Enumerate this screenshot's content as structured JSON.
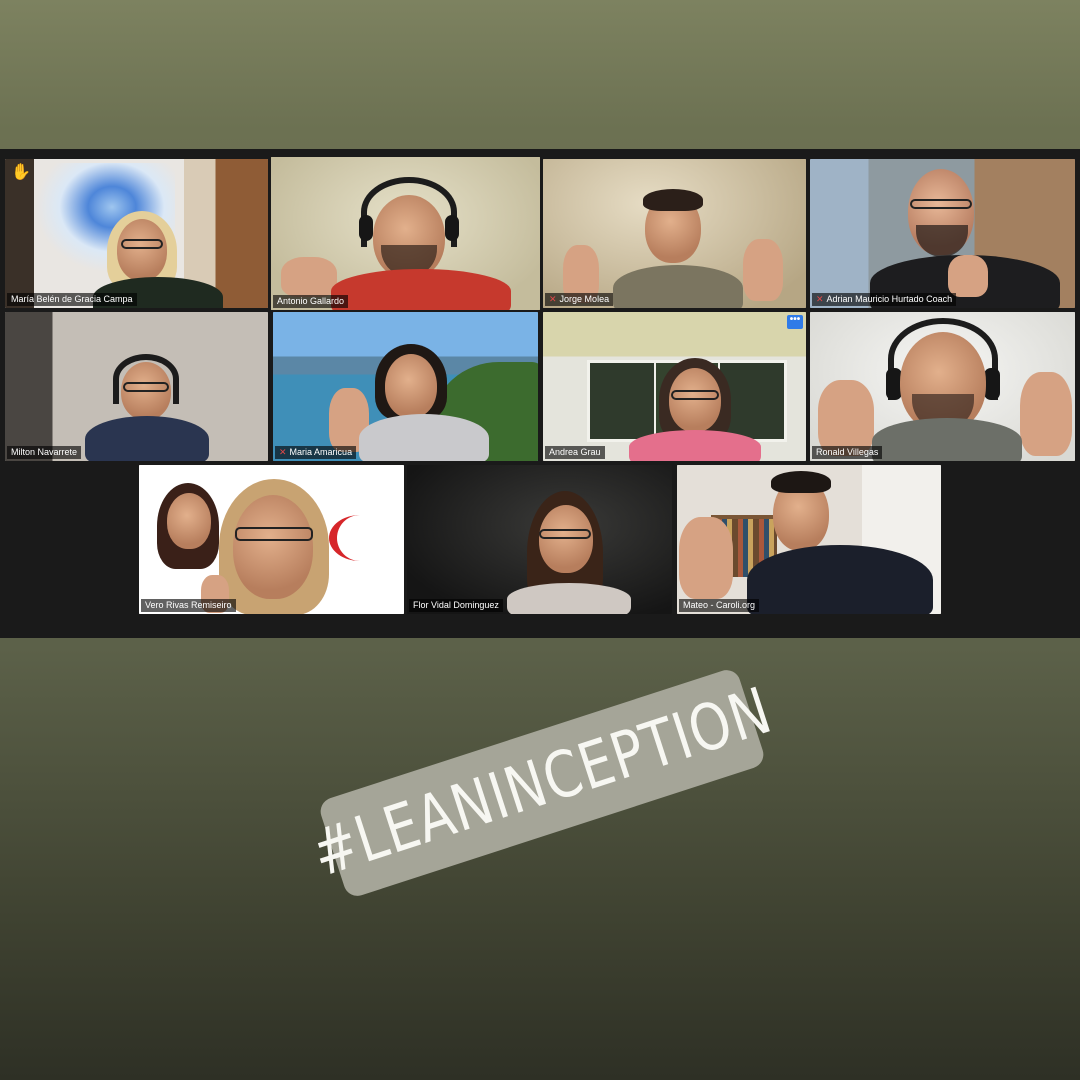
{
  "meeting": {
    "participants": [
      {
        "name": "María Belén de Gracia Campa",
        "muted": false
      },
      {
        "name": "Antonio Gallardo",
        "muted": false
      },
      {
        "name": "Jorge Molea",
        "muted": true
      },
      {
        "name": "Adrian Mauricio Hurtado Coach",
        "muted": true
      },
      {
        "name": "Milton Navarrete",
        "muted": false
      },
      {
        "name": "Maria Amaricua",
        "muted": true
      },
      {
        "name": "Andrea Grau",
        "muted": false
      },
      {
        "name": "Ronald Villegas",
        "muted": false
      },
      {
        "name": "Vero Rivas Remiseiro",
        "muted": false
      },
      {
        "name": "Flor Vidal Dominguez",
        "muted": false
      },
      {
        "name": "Mateo - Caroli.org",
        "muted": false
      }
    ],
    "more_button_label": "•••",
    "raise_hand_icon": "✋",
    "active_speaker_color": "#e8e08a"
  },
  "overlay": {
    "hashtag": "#LEANINCEPTION"
  },
  "colors": {
    "background_top": "#7d8260",
    "background_bottom": "#2e3025",
    "gallery": "#1a1a1a",
    "pill": "#a5a598",
    "mute_icon": "#e04848",
    "more_button": "#2f7be8"
  }
}
